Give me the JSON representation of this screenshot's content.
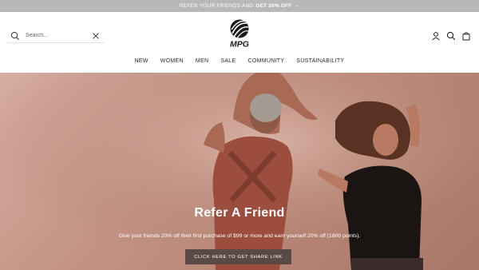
{
  "promo": {
    "text": "REFER YOUR FRIENDS AND",
    "strong": "GET 20% OFF",
    "arrow": "→"
  },
  "search": {
    "placeholder": "Search..."
  },
  "logo": {
    "text": "MPG"
  },
  "nav": {
    "items": [
      {
        "label": "NEW"
      },
      {
        "label": "WOMEN"
      },
      {
        "label": "MEN"
      },
      {
        "label": "SALE"
      },
      {
        "label": "COMMUNITY"
      },
      {
        "label": "SUSTAINABILITY"
      }
    ]
  },
  "header_icons": [
    "account-icon",
    "search-icon",
    "bag-icon"
  ],
  "hero": {
    "title": "Refer A Friend",
    "text": "Give your friends 20% off their first purchase of $99 or more and earn yourself 20% off (1800 points).",
    "button_label": "CLICK HERE TO GET SHARE LINK"
  },
  "colors": {
    "promo_bg": "#b8b8b8",
    "hero_bg": "#c29384",
    "button_bg": "#5a4944"
  }
}
